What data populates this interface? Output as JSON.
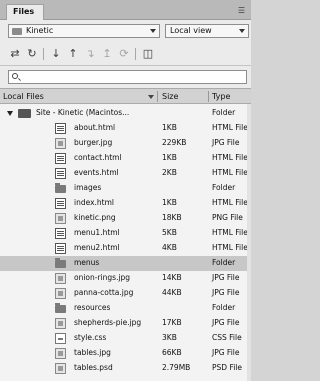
{
  "panel": {
    "tab_label": "Files"
  },
  "selectors": {
    "site": "Kinetic",
    "view": "Local view"
  },
  "toolbar": {
    "icons": [
      "connect-icon",
      "refresh-icon",
      "get-icon",
      "put-icon",
      "checkout-icon",
      "checkin-icon",
      "sync-icon",
      "expand-icon"
    ]
  },
  "search": {
    "value": "",
    "placeholder": ""
  },
  "columns": {
    "name": "Local Files",
    "size": "Size",
    "type": "Type"
  },
  "site_row": {
    "name": "Site - Kinetic (Macintos...",
    "size": "",
    "type": "Folder"
  },
  "files": [
    {
      "name": "about.html",
      "size": "1KB",
      "type": "HTML File",
      "icon": "html-file-icon"
    },
    {
      "name": "burger.jpg",
      "size": "229KB",
      "type": "JPG File",
      "icon": "image-file-icon"
    },
    {
      "name": "contact.html",
      "size": "1KB",
      "type": "HTML File",
      "icon": "html-file-icon"
    },
    {
      "name": "events.html",
      "size": "2KB",
      "type": "HTML File",
      "icon": "html-file-icon"
    },
    {
      "name": "images",
      "size": "",
      "type": "Folder",
      "icon": "folder-icon"
    },
    {
      "name": "index.html",
      "size": "1KB",
      "type": "HTML File",
      "icon": "html-file-icon"
    },
    {
      "name": "kinetic.png",
      "size": "18KB",
      "type": "PNG File",
      "icon": "image-file-icon"
    },
    {
      "name": "menu1.html",
      "size": "5KB",
      "type": "HTML File",
      "icon": "html-file-icon"
    },
    {
      "name": "menu2.html",
      "size": "4KB",
      "type": "HTML File",
      "icon": "html-file-icon"
    },
    {
      "name": "menus",
      "size": "",
      "type": "Folder",
      "icon": "folder-icon",
      "selected": true
    },
    {
      "name": "onion-rings.jpg",
      "size": "14KB",
      "type": "JPG File",
      "icon": "image-file-icon"
    },
    {
      "name": "panna-cotta.jpg",
      "size": "44KB",
      "type": "JPG File",
      "icon": "image-file-icon"
    },
    {
      "name": "resources",
      "size": "",
      "type": "Folder",
      "icon": "folder-icon"
    },
    {
      "name": "shepherds-pie.jpg",
      "size": "17KB",
      "type": "JPG File",
      "icon": "image-file-icon"
    },
    {
      "name": "style.css",
      "size": "3KB",
      "type": "CSS File",
      "icon": "css-file-icon"
    },
    {
      "name": "tables.jpg",
      "size": "66KB",
      "type": "JPG File",
      "icon": "image-file-icon"
    },
    {
      "name": "tables.psd",
      "size": "2.79MB",
      "type": "PSD File",
      "icon": "image-file-icon"
    }
  ]
}
